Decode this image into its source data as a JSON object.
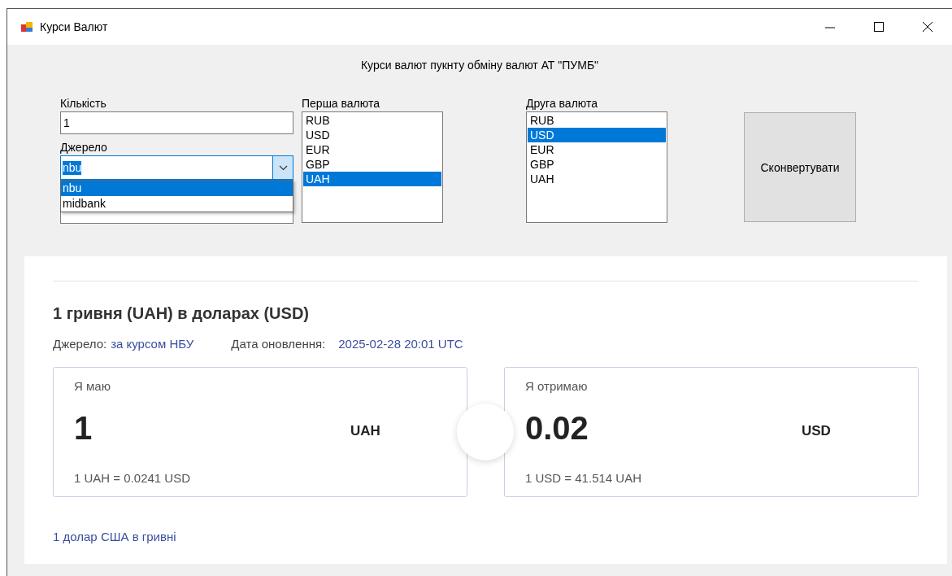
{
  "window": {
    "title": "Курси Валют"
  },
  "form": {
    "header": "Курси валют пукнту обміну валют АТ \"ПУМБ\"",
    "amount": {
      "label": "Кількість",
      "value": "1"
    },
    "source": {
      "label": "Джерело",
      "value": "nbu",
      "expanded": true,
      "options": [
        {
          "label": "nbu",
          "selected": true
        },
        {
          "label": "midbank",
          "selected": false
        }
      ]
    },
    "first_currency": {
      "label": "Перша валюта",
      "items": [
        {
          "label": "RUB",
          "selected": false
        },
        {
          "label": "USD",
          "selected": false
        },
        {
          "label": "EUR",
          "selected": false
        },
        {
          "label": "GBP",
          "selected": false
        },
        {
          "label": "UAH",
          "selected": true
        }
      ]
    },
    "second_currency": {
      "label": "Друга валюта",
      "items": [
        {
          "label": "RUB",
          "selected": false
        },
        {
          "label": "USD",
          "selected": true
        },
        {
          "label": "EUR",
          "selected": false
        },
        {
          "label": "GBP",
          "selected": false
        },
        {
          "label": "UAH",
          "selected": false
        }
      ]
    },
    "convert_button": "Сконвертувати"
  },
  "result": {
    "title": "1 гривня (UAH) в доларах (USD)",
    "source_label": "Джерело:",
    "source_value": "за курсом НБУ",
    "date_label": "Дата оновлення:",
    "date_value": "2025-02-28 20:01 UTC",
    "cards": [
      {
        "label": "Я маю",
        "amount": "1",
        "currency": "UAH",
        "rate": "1 UAH = 0.0241 USD"
      },
      {
        "label": "Я отримаю",
        "amount": "0.02",
        "currency": "USD",
        "rate": "1 USD = 41.514 UAH"
      }
    ],
    "link": "1 долар США в гривні"
  }
}
